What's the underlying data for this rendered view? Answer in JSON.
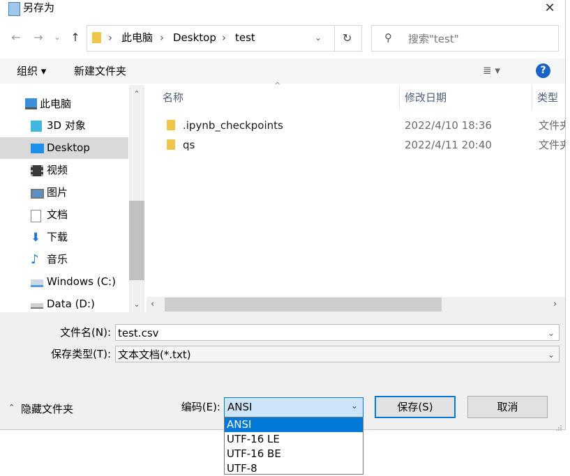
{
  "window": {
    "title": "另存为",
    "close_icon": "close-icon"
  },
  "nav": {
    "back_icon": "←",
    "forward_icon": "→",
    "recent_icon": "⌄",
    "up_icon": "↑",
    "breadcrumb": [
      "此电脑",
      "Desktop",
      "test"
    ],
    "refresh_icon": "↻",
    "search_placeholder": "搜索\"test\""
  },
  "toolbar": {
    "organize_label": "组织 ▾",
    "new_folder_label": "新建文件夹",
    "view_icon": "≣ ▾",
    "help_label": "?"
  },
  "sidebar": {
    "items": [
      {
        "label": "此电脑",
        "icon": "computer-icon"
      },
      {
        "label": "3D 对象",
        "icon": "cube-icon"
      },
      {
        "label": "Desktop",
        "icon": "desktop-icon",
        "selected": true
      },
      {
        "label": "视频",
        "icon": "video-icon"
      },
      {
        "label": "图片",
        "icon": "picture-icon"
      },
      {
        "label": "文档",
        "icon": "document-icon"
      },
      {
        "label": "下载",
        "icon": "download-icon"
      },
      {
        "label": "音乐",
        "icon": "music-icon"
      },
      {
        "label": "Windows (C:)",
        "icon": "drive-icon"
      },
      {
        "label": "Data (D:)",
        "icon": "drive-icon"
      }
    ]
  },
  "file_list": {
    "columns": [
      "名称",
      "修改日期",
      "类型"
    ],
    "rows": [
      {
        "name": ".ipynb_checkpoints",
        "date": "2022/4/10 18:36",
        "type": "文件夹"
      },
      {
        "name": "qs",
        "date": "2022/4/11 20:40",
        "type": "文件夹"
      }
    ]
  },
  "form": {
    "filename_label": "文件名(N):",
    "filename_value": "test.csv",
    "filetype_label": "保存类型(T):",
    "filetype_value": "文本文档(*.txt)",
    "hide_folders_label": "隐藏文件夹",
    "encoding_label": "编码(E):",
    "encoding_value": "ANSI",
    "encoding_options": [
      "ANSI",
      "UTF-16 LE",
      "UTF-16 BE",
      "UTF-8"
    ],
    "save_label": "保存(S)",
    "cancel_label": "取消"
  },
  "colors": {
    "accent": "#0078d7",
    "folder": "#f0c54a",
    "help": "#1a63c4",
    "selection": "#d9d9d9"
  }
}
